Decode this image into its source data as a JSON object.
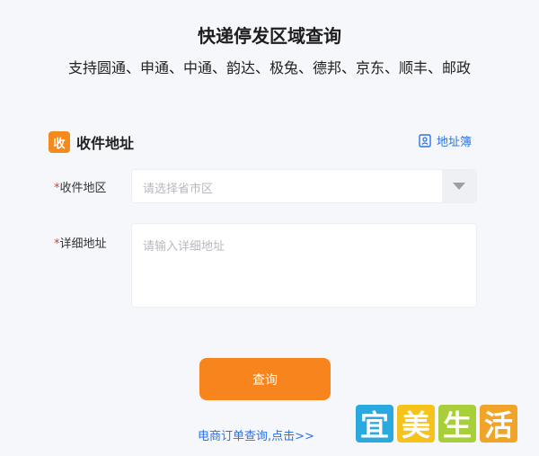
{
  "header": {
    "title": "快递停发区域查询",
    "subtitle": "支持圆通、申通、中通、韵达、极兔、德邦、京东、顺丰、邮政"
  },
  "section": {
    "badge": "收",
    "title": "收件地址",
    "address_book": "地址簿"
  },
  "form": {
    "required_mark": "*",
    "region_label": "收件地区",
    "region_placeholder": "请选择省市区",
    "detail_label": "详细地址",
    "detail_placeholder": "请输入详细地址"
  },
  "actions": {
    "query": "查询",
    "ecommerce_link": "电商订单查询,点击>>"
  },
  "watermark": {
    "chars": [
      "宜",
      "美",
      "生",
      "活"
    ],
    "colors": [
      "#2aa8e0",
      "#f6c21c",
      "#a8cf3a",
      "#f0a42a"
    ]
  },
  "colors": {
    "accent": "#f7841d",
    "link": "#2a72e8",
    "required": "#e53935"
  }
}
